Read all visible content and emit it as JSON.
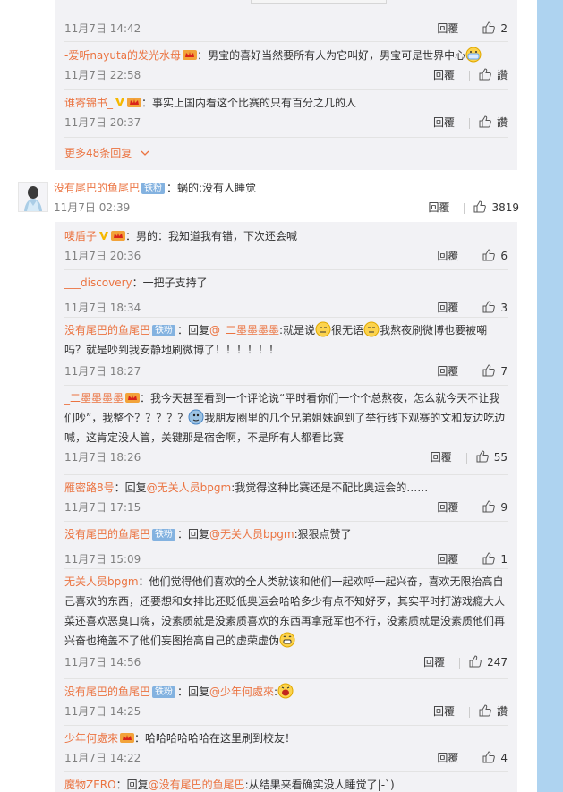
{
  "partial_top": {
    "time": "11月7日 14:42",
    "reply_label": "回覆",
    "likes": "2"
  },
  "replies_a": [
    {
      "user": "-爱听nayuta的发光水母",
      "text": "：男宝的喜好当然要所有人为它叫好，男宝可是世界中心",
      "time": "11月7日 22:58",
      "reply_label": "回覆",
      "likes": "讚"
    },
    {
      "user": "谁寄锦书_",
      "text": "：事实上国内看这个比赛的只有百分之几的人",
      "time": "11月7日 20:37",
      "reply_label": "回覆",
      "likes": "讚"
    }
  ],
  "more_replies": "更多48条回复",
  "main_comment": {
    "user": "没有尾巴的鱼尾巴",
    "fan_badge": "铁粉",
    "text": "：蜗的:没有人睡觉",
    "time": "11月7日 02:39",
    "reply_label": "回覆",
    "likes": "3819"
  },
  "replies_b": [
    {
      "user": "唛盾子",
      "text": "：男的：我知道我有错，下次还会喊",
      "time": "11月7日 20:36",
      "reply_label": "回覆",
      "likes": "6"
    },
    {
      "user": "___discovery",
      "text": "：一把子支持了",
      "time": "11月7日 18:34",
      "reply_label": "回覆",
      "likes": "3"
    },
    {
      "user": "没有尾巴的鱼尾巴",
      "fan_badge": "铁粉",
      "pre": "：回复",
      "mention": "@_二墨墨墨墨",
      "text1": ":就是说",
      "text2": "很无语",
      "text3": "我熬夜刷微博也要被嘲吗？就是吵到我安静地刷微博了！！！！！！",
      "time": "11月7日 18:27",
      "reply_label": "回覆",
      "likes": "7"
    },
    {
      "user": "_二墨墨墨墨",
      "text1": "：我今天甚至看到一个评论说“平时看你们一个个总熬夜，怎么就今天不让我们吵”，我整个？？？？？",
      "text2": "我朋友圈里的几个兄弟姐妹跑到了举行线下观赛的文和友边吃边喊，这肯定没人管，关键那是宿舍啊，不是所有人都看比赛",
      "time": "11月7日 18:26",
      "reply_label": "回覆",
      "likes": "55"
    },
    {
      "user": "雁密路8号",
      "pre": "：回复",
      "mention": "@无关人员bpgm",
      "text": ":我觉得这种比赛还是不配比奥运会的……",
      "time": "11月7日 17:15",
      "reply_label": "回覆",
      "likes": "9"
    },
    {
      "user": "没有尾巴的鱼尾巴",
      "fan_badge": "铁粉",
      "pre": "：回复",
      "mention": "@无关人员bpgm",
      "text": ":狠狠点赞了",
      "time": "11月7日 15:09",
      "reply_label": "回覆",
      "likes": "1"
    },
    {
      "user": "无关人员bpgm",
      "text": "：他们觉得他们喜欢的全人类就该和他们一起欢呼一起兴奋，喜欢无限抬高自己喜欢的东西，还要想和女排比还贬低奥运会哈哈多少有点不知好歹，其实平时打游戏瘾大人菜还喜欢恶臭口嗨，没素质就是没素质喜欢的东西再拿冠军也不行，没素质就是没素质他们再兴奋也掩盖不了他们妄图抬高自己的虚荣虚伪",
      "time": "11月7日 14:56",
      "reply_label": "回覆",
      "likes": "247"
    },
    {
      "user": "没有尾巴的鱼尾巴",
      "fan_badge": "铁粉",
      "pre": "：回复",
      "mention": "@少年何處來",
      "text": ":",
      "time": "11月7日 14:25",
      "reply_label": "回覆",
      "likes": "讚"
    },
    {
      "user": "少年何處來",
      "text": "：哈哈哈哈哈哈在这里刷到校友！",
      "time": "11月7日 14:22",
      "reply_label": "回覆",
      "likes": "4"
    },
    {
      "user": "魔物ZERO",
      "pre": "：回复",
      "mention": "@没有尾巴的鱼尾巴",
      "text": ":从结果来看确实没人睡觉了|-`)"
    }
  ]
}
